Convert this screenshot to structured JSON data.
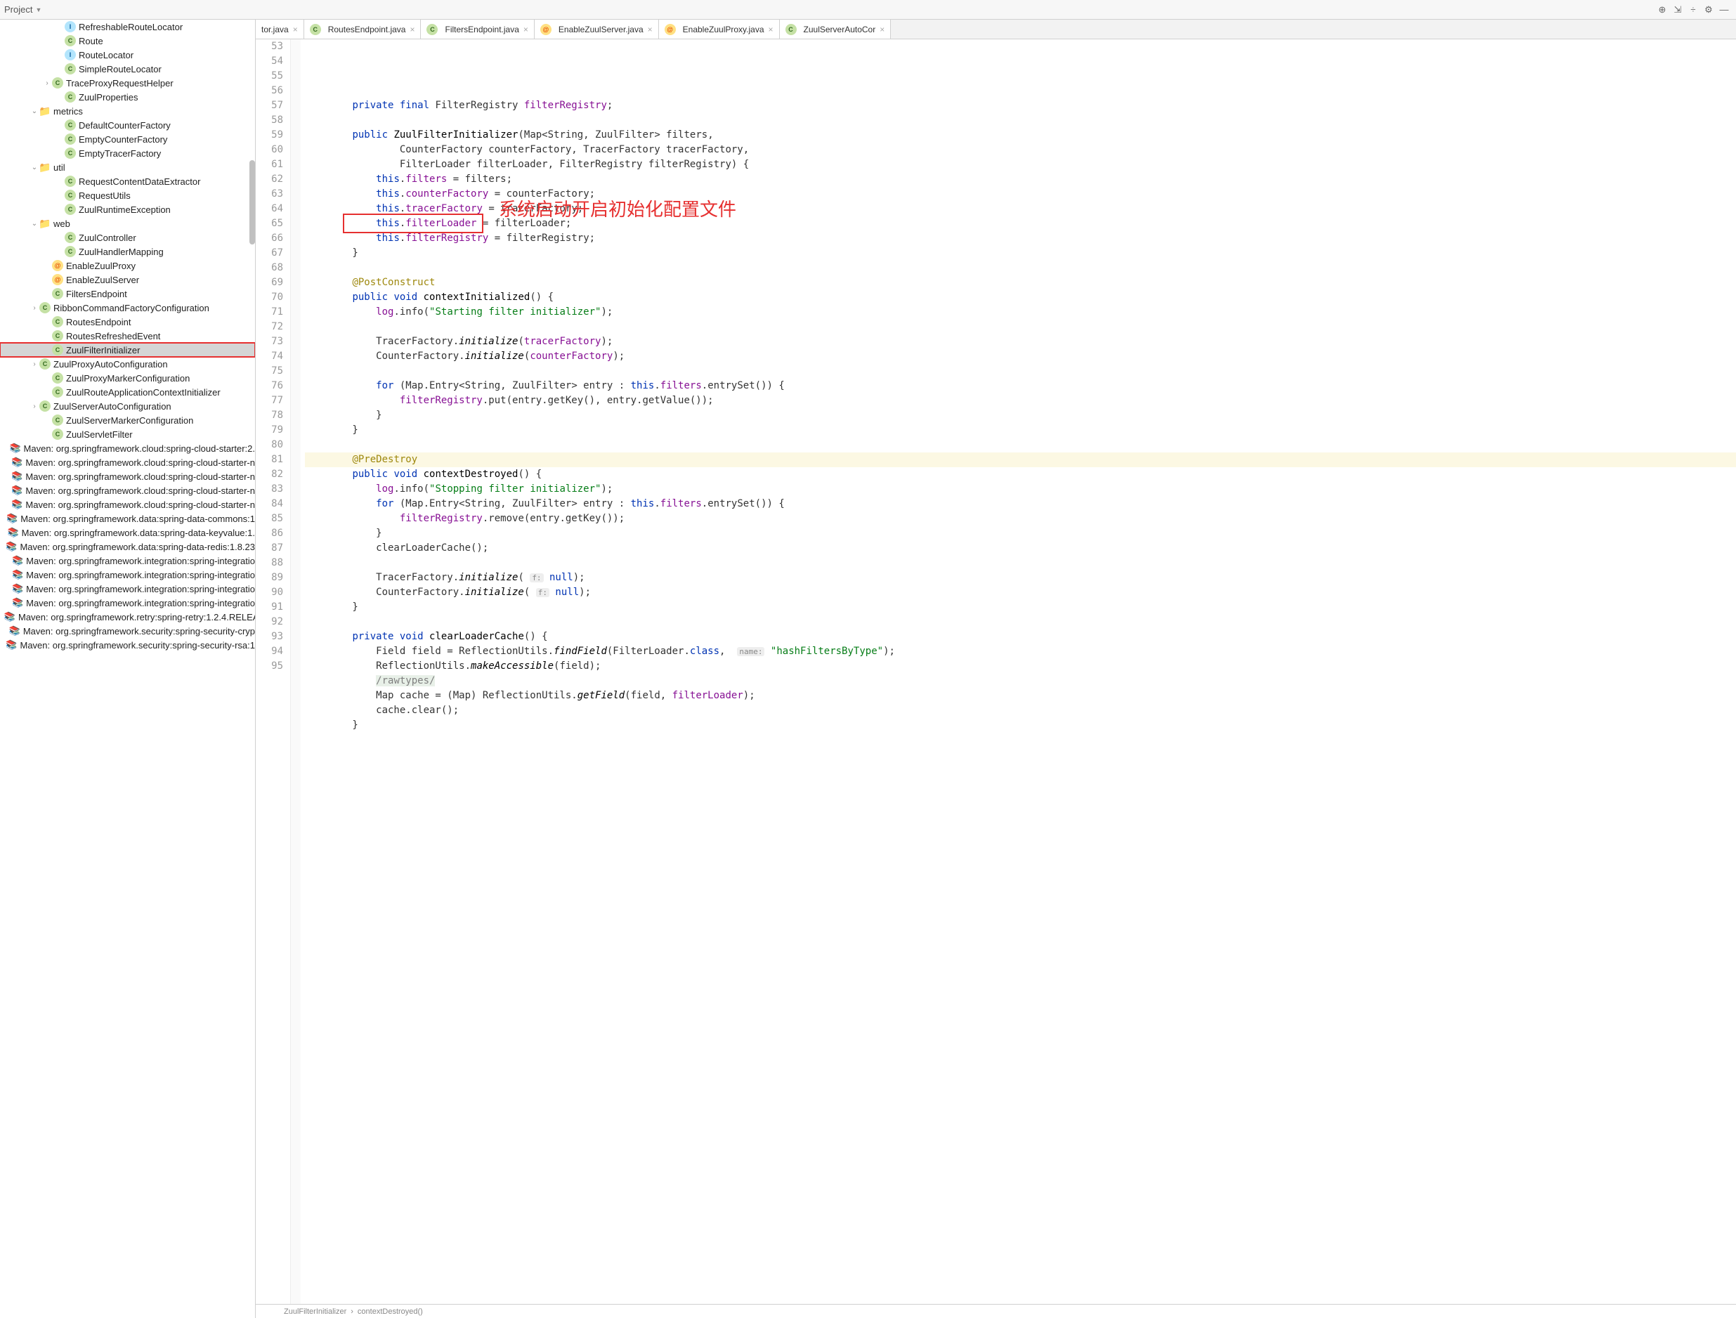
{
  "toolbar": {
    "project": "Project"
  },
  "tree": [
    {
      "indent": 4,
      "exp": "",
      "ic": "ic-interface",
      "ch": "I",
      "label": "RefreshableRouteLocator",
      "sel": false,
      "box": false
    },
    {
      "indent": 4,
      "exp": "",
      "ic": "ic-class",
      "ch": "C",
      "label": "Route",
      "sel": false,
      "box": false
    },
    {
      "indent": 4,
      "exp": "",
      "ic": "ic-interface",
      "ch": "I",
      "label": "RouteLocator",
      "sel": false,
      "box": false
    },
    {
      "indent": 4,
      "exp": "",
      "ic": "ic-class",
      "ch": "C",
      "label": "SimpleRouteLocator",
      "sel": false,
      "box": false
    },
    {
      "indent": 3,
      "exp": "›",
      "ic": "ic-class",
      "ch": "C",
      "label": "TraceProxyRequestHelper",
      "sel": false,
      "box": false
    },
    {
      "indent": 4,
      "exp": "",
      "ic": "ic-class",
      "ch": "C",
      "label": "ZuulProperties",
      "sel": false,
      "box": false
    },
    {
      "indent": 2,
      "exp": "⌄",
      "ic": "ic-folder",
      "ch": "📁",
      "label": "metrics",
      "sel": false,
      "box": false
    },
    {
      "indent": 4,
      "exp": "",
      "ic": "ic-class",
      "ch": "C",
      "label": "DefaultCounterFactory",
      "sel": false,
      "box": false
    },
    {
      "indent": 4,
      "exp": "",
      "ic": "ic-class",
      "ch": "C",
      "label": "EmptyCounterFactory",
      "sel": false,
      "box": false
    },
    {
      "indent": 4,
      "exp": "",
      "ic": "ic-class",
      "ch": "C",
      "label": "EmptyTracerFactory",
      "sel": false,
      "box": false
    },
    {
      "indent": 2,
      "exp": "⌄",
      "ic": "ic-folder",
      "ch": "📁",
      "label": "util",
      "sel": false,
      "box": false
    },
    {
      "indent": 4,
      "exp": "",
      "ic": "ic-class",
      "ch": "C",
      "label": "RequestContentDataExtractor",
      "sel": false,
      "box": false
    },
    {
      "indent": 4,
      "exp": "",
      "ic": "ic-class",
      "ch": "C",
      "label": "RequestUtils",
      "sel": false,
      "box": false
    },
    {
      "indent": 4,
      "exp": "",
      "ic": "ic-class",
      "ch": "C",
      "label": "ZuulRuntimeException",
      "sel": false,
      "box": false
    },
    {
      "indent": 2,
      "exp": "⌄",
      "ic": "ic-folder",
      "ch": "📁",
      "label": "web",
      "sel": false,
      "box": false
    },
    {
      "indent": 4,
      "exp": "",
      "ic": "ic-class",
      "ch": "C",
      "label": "ZuulController",
      "sel": false,
      "box": false
    },
    {
      "indent": 4,
      "exp": "",
      "ic": "ic-class",
      "ch": "C",
      "label": "ZuulHandlerMapping",
      "sel": false,
      "box": false
    },
    {
      "indent": 3,
      "exp": "",
      "ic": "ic-anno",
      "ch": "@",
      "label": "EnableZuulProxy",
      "sel": false,
      "box": false
    },
    {
      "indent": 3,
      "exp": "",
      "ic": "ic-anno",
      "ch": "@",
      "label": "EnableZuulServer",
      "sel": false,
      "box": false
    },
    {
      "indent": 3,
      "exp": "",
      "ic": "ic-class",
      "ch": "C",
      "label": "FiltersEndpoint",
      "sel": false,
      "box": false
    },
    {
      "indent": 2,
      "exp": "›",
      "ic": "ic-class",
      "ch": "C",
      "label": "RibbonCommandFactoryConfiguration",
      "sel": false,
      "box": false
    },
    {
      "indent": 3,
      "exp": "",
      "ic": "ic-class",
      "ch": "C",
      "label": "RoutesEndpoint",
      "sel": false,
      "box": false
    },
    {
      "indent": 3,
      "exp": "",
      "ic": "ic-class",
      "ch": "C",
      "label": "RoutesRefreshedEvent",
      "sel": false,
      "box": false
    },
    {
      "indent": 3,
      "exp": "",
      "ic": "ic-class",
      "ch": "C",
      "label": "ZuulFilterInitializer",
      "sel": true,
      "box": true
    },
    {
      "indent": 2,
      "exp": "›",
      "ic": "ic-class",
      "ch": "C",
      "label": "ZuulProxyAutoConfiguration",
      "sel": false,
      "box": false
    },
    {
      "indent": 3,
      "exp": "",
      "ic": "ic-class",
      "ch": "C",
      "label": "ZuulProxyMarkerConfiguration",
      "sel": false,
      "box": false
    },
    {
      "indent": 3,
      "exp": "",
      "ic": "ic-class",
      "ch": "C",
      "label": "ZuulRouteApplicationContextInitializer",
      "sel": false,
      "box": false
    },
    {
      "indent": 2,
      "exp": "›",
      "ic": "ic-class",
      "ch": "C",
      "label": "ZuulServerAutoConfiguration",
      "sel": false,
      "box": false
    },
    {
      "indent": 3,
      "exp": "",
      "ic": "ic-class",
      "ch": "C",
      "label": "ZuulServerMarkerConfiguration",
      "sel": false,
      "box": false
    },
    {
      "indent": 3,
      "exp": "",
      "ic": "ic-class",
      "ch": "C",
      "label": "ZuulServletFilter",
      "sel": false,
      "box": false
    },
    {
      "indent": 0,
      "exp": "",
      "ic": "ic-lib",
      "ch": "📚",
      "label": "Maven: org.springframework.cloud:spring-cloud-starter:2.",
      "sel": false,
      "box": false
    },
    {
      "indent": 0,
      "exp": "",
      "ic": "ic-lib",
      "ch": "📚",
      "label": "Maven: org.springframework.cloud:spring-cloud-starter-n",
      "sel": false,
      "box": false
    },
    {
      "indent": 0,
      "exp": "",
      "ic": "ic-lib",
      "ch": "📚",
      "label": "Maven: org.springframework.cloud:spring-cloud-starter-n",
      "sel": false,
      "box": false
    },
    {
      "indent": 0,
      "exp": "",
      "ic": "ic-lib",
      "ch": "📚",
      "label": "Maven: org.springframework.cloud:spring-cloud-starter-n",
      "sel": false,
      "box": false
    },
    {
      "indent": 0,
      "exp": "",
      "ic": "ic-lib",
      "ch": "📚",
      "label": "Maven: org.springframework.cloud:spring-cloud-starter-n",
      "sel": false,
      "box": false
    },
    {
      "indent": 0,
      "exp": "",
      "ic": "ic-lib",
      "ch": "📚",
      "label": "Maven: org.springframework.data:spring-data-commons:1",
      "sel": false,
      "box": false
    },
    {
      "indent": 0,
      "exp": "",
      "ic": "ic-lib",
      "ch": "📚",
      "label": "Maven: org.springframework.data:spring-data-keyvalue:1.",
      "sel": false,
      "box": false
    },
    {
      "indent": 0,
      "exp": "",
      "ic": "ic-lib",
      "ch": "📚",
      "label": "Maven: org.springframework.data:spring-data-redis:1.8.23",
      "sel": false,
      "box": false
    },
    {
      "indent": 0,
      "exp": "",
      "ic": "ic-lib",
      "ch": "📚",
      "label": "Maven: org.springframework.integration:spring-integratio",
      "sel": false,
      "box": false
    },
    {
      "indent": 0,
      "exp": "",
      "ic": "ic-lib",
      "ch": "📚",
      "label": "Maven: org.springframework.integration:spring-integratio",
      "sel": false,
      "box": false
    },
    {
      "indent": 0,
      "exp": "",
      "ic": "ic-lib",
      "ch": "📚",
      "label": "Maven: org.springframework.integration:spring-integratio",
      "sel": false,
      "box": false
    },
    {
      "indent": 0,
      "exp": "",
      "ic": "ic-lib",
      "ch": "📚",
      "label": "Maven: org.springframework.integration:spring-integratio",
      "sel": false,
      "box": false
    },
    {
      "indent": 0,
      "exp": "",
      "ic": "ic-lib",
      "ch": "📚",
      "label": "Maven: org.springframework.retry:spring-retry:1.2.4.RELEA",
      "sel": false,
      "box": false
    },
    {
      "indent": 0,
      "exp": "",
      "ic": "ic-lib",
      "ch": "📚",
      "label": "Maven: org.springframework.security:spring-security-cryp",
      "sel": false,
      "box": false
    },
    {
      "indent": 0,
      "exp": "",
      "ic": "ic-lib",
      "ch": "📚",
      "label": "Maven: org.springframework.security:spring-security-rsa:1",
      "sel": false,
      "box": false
    }
  ],
  "tabs": [
    {
      "ic": "ic-class",
      "ch": "",
      "label": "tor.java",
      "active": false
    },
    {
      "ic": "ic-class",
      "ch": "C",
      "label": "RoutesEndpoint.java",
      "active": false
    },
    {
      "ic": "ic-class",
      "ch": "C",
      "label": "FiltersEndpoint.java",
      "active": false
    },
    {
      "ic": "ic-anno",
      "ch": "@",
      "label": "EnableZuulServer.java",
      "active": false
    },
    {
      "ic": "ic-anno",
      "ch": "@",
      "label": "EnableZuulProxy.java",
      "active": false
    },
    {
      "ic": "ic-class",
      "ch": "C",
      "label": "ZuulServerAutoCor",
      "active": false
    }
  ],
  "gutter_start": 53,
  "gutter_count": 43,
  "annotation_cn": "系统启动开启初始化配置文件",
  "breadcrumb": {
    "class": "ZuulFilterInitializer",
    "method": "contextDestroyed()"
  },
  "code_lines": [
    {
      "n": 53,
      "html": "        <span class='kw'>private final</span> FilterRegistry <span class='field'>filterRegistry</span>;"
    },
    {
      "n": 54,
      "html": ""
    },
    {
      "n": 55,
      "html": "        <span class='kw'>public</span> <span class='ident'>ZuulFilterInitializer</span>(Map&lt;String, ZuulFilter&gt; filters,"
    },
    {
      "n": 56,
      "html": "                CounterFactory counterFactory, TracerFactory tracerFactory,"
    },
    {
      "n": 57,
      "html": "                FilterLoader filterLoader, FilterRegistry filterRegistry) {"
    },
    {
      "n": 58,
      "html": "            <span class='kw'>this</span>.<span class='field'>filters</span> = filters;"
    },
    {
      "n": 59,
      "html": "            <span class='kw'>this</span>.<span class='field'>counterFactory</span> = counterFactory;"
    },
    {
      "n": 60,
      "html": "            <span class='kw'>this</span>.<span class='field'>tracerFactory</span> = tracerFactory;"
    },
    {
      "n": 61,
      "html": "            <span class='kw'>this</span>.<span class='field'>filterLoader</span> = filterLoader;"
    },
    {
      "n": 62,
      "html": "            <span class='kw'>this</span>.<span class='field'>filterRegistry</span> = filterRegistry;"
    },
    {
      "n": 63,
      "html": "        }"
    },
    {
      "n": 64,
      "html": ""
    },
    {
      "n": 65,
      "html": "        <span class='anno'>@PostConstruct</span>"
    },
    {
      "n": 66,
      "html": "        <span class='kw'>public void</span> <span class='ident'>contextInitialized</span>() {"
    },
    {
      "n": 67,
      "html": "            <span class='field'>log</span>.info(<span class='str'>\"Starting filter initializer\"</span>);"
    },
    {
      "n": 68,
      "html": ""
    },
    {
      "n": 69,
      "html": "            TracerFactory.<span class='method-static'>initialize</span>(<span class='field'>tracerFactory</span>);"
    },
    {
      "n": 70,
      "html": "            CounterFactory.<span class='method-static'>initialize</span>(<span class='field'>counterFactory</span>);"
    },
    {
      "n": 71,
      "html": ""
    },
    {
      "n": 72,
      "html": "            <span class='kw'>for</span> (Map.Entry&lt;String, ZuulFilter&gt; entry : <span class='kw'>this</span>.<span class='field'>filters</span>.entrySet()) {"
    },
    {
      "n": 73,
      "html": "                <span class='field'>filterRegistry</span>.put(entry.getKey(), entry.getValue());"
    },
    {
      "n": 74,
      "html": "            }"
    },
    {
      "n": 75,
      "html": "        }"
    },
    {
      "n": 76,
      "html": ""
    },
    {
      "n": 77,
      "html": "        <span class='anno'>@PreDestroy</span>",
      "hl": true
    },
    {
      "n": 78,
      "html": "        <span class='kw'>public void</span> <span class='ident'>contextDestroyed</span>() {"
    },
    {
      "n": 79,
      "html": "            <span class='field'>log</span>.info(<span class='str'>\"Stopping filter initializer\"</span>);"
    },
    {
      "n": 80,
      "html": "            <span class='kw'>for</span> (Map.Entry&lt;String, ZuulFilter&gt; entry : <span class='kw'>this</span>.<span class='field'>filters</span>.entrySet()) {"
    },
    {
      "n": 81,
      "html": "                <span class='field'>filterRegistry</span>.remove(entry.getKey());"
    },
    {
      "n": 82,
      "html": "            }"
    },
    {
      "n": 83,
      "html": "            clearLoaderCache();"
    },
    {
      "n": 84,
      "html": ""
    },
    {
      "n": 85,
      "html": "            TracerFactory.<span class='method-static'>initialize</span>( <span class='param-hint'>f:</span> <span class='kw'>null</span>);"
    },
    {
      "n": 86,
      "html": "            CounterFactory.<span class='method-static'>initialize</span>( <span class='param-hint'>f:</span> <span class='kw'>null</span>);"
    },
    {
      "n": 87,
      "html": "        }"
    },
    {
      "n": 88,
      "html": ""
    },
    {
      "n": 89,
      "html": "        <span class='kw'>private void</span> <span class='ident'>clearLoaderCache</span>() {"
    },
    {
      "n": 90,
      "html": "            Field field = ReflectionUtils.<span class='method-static'>findField</span>(FilterLoader.<span class='kw'>class</span>,  <span class='param-hint'>name:</span> <span class='str'>\"hashFiltersByType\"</span>);"
    },
    {
      "n": 91,
      "html": "            ReflectionUtils.<span class='method-static'>makeAccessible</span>(field);"
    },
    {
      "n": 92,
      "html": "            <span class='comment-block'>/rawtypes/</span>"
    },
    {
      "n": 93,
      "html": "            Map cache = (Map) ReflectionUtils.<span class='method-static'>getField</span>(field, <span class='field'>filterLoader</span>);"
    },
    {
      "n": 94,
      "html": "            cache.clear();"
    },
    {
      "n": 95,
      "html": "        }"
    }
  ]
}
